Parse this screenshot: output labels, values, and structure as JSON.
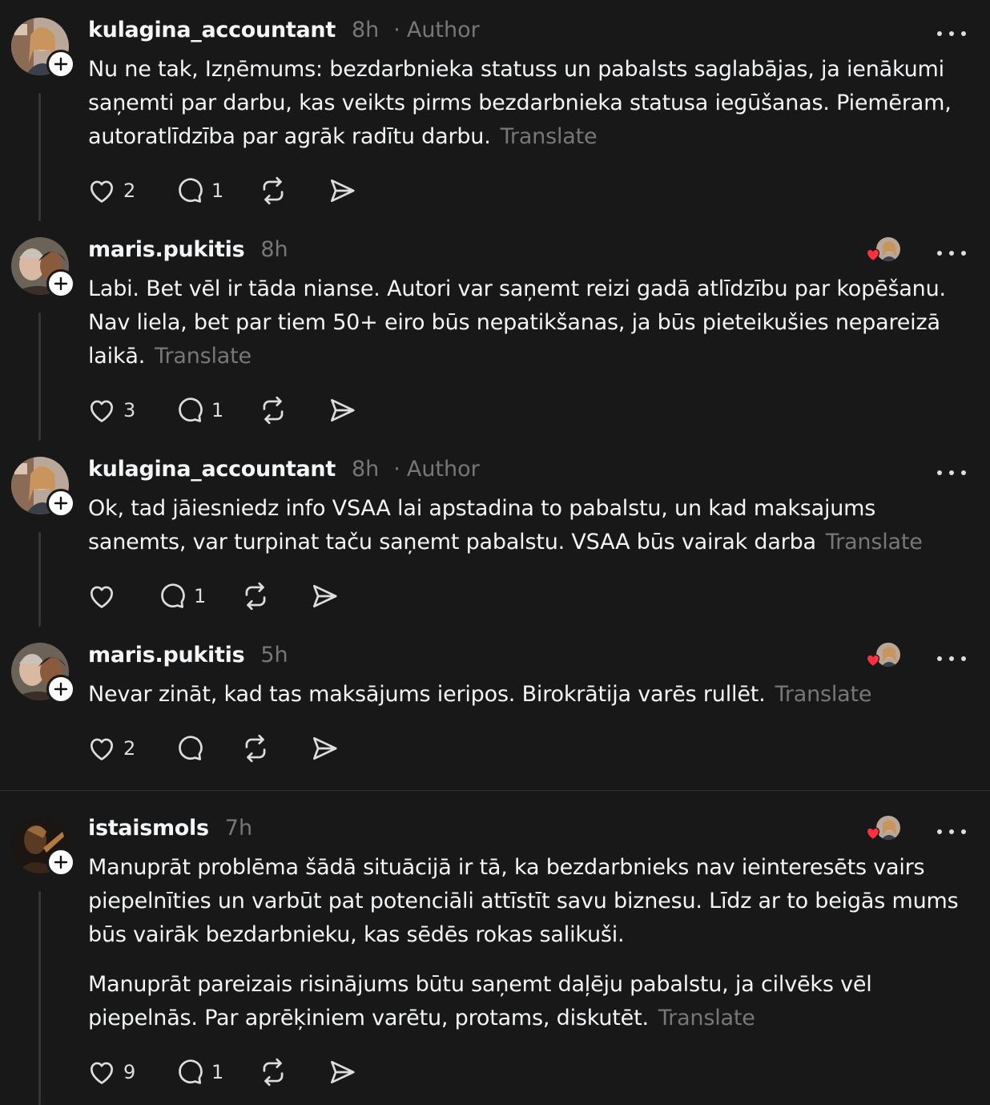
{
  "posts": [
    {
      "username": "kulagina_accountant",
      "time": "8h",
      "author_badge": "Author",
      "paragraphs": [
        "Nu ne tak, Izņēmums: bezdarbnieka statuss un pabalsts saglabājas, ja ienākumi saņemti par darbu, kas veikts pirms bezdarbnieka statusa iegūšanas. Piemēram, autoratlīdzība par agrāk radītu darbu."
      ],
      "translate": "Translate",
      "likes": "2",
      "replies": "1",
      "avatar_icon": "profile-photo-woman"
    },
    {
      "username": "maris.pukitis",
      "time": "8h",
      "paragraphs": [
        "Labi. Bet vēl ir tāda nianse. Autori var saņemt reizi gadā atlīdzību par kopēšanu. Nav liela, bet par tiem 50+ eiro būs nepatikšanas, ja būs pieteikušies nepareizā laikā."
      ],
      "translate": "Translate",
      "likes": "3",
      "replies": "1",
      "avatar_icon": "profile-photo-couple"
    },
    {
      "username": "kulagina_accountant",
      "time": "8h",
      "author_badge": "Author",
      "paragraphs": [
        "Ok, tad jāiesniedz info VSAA lai apstadina to pabalstu, un kad maksajums sanemts, var turpinat taču saņemt pabalstu. VSAA būs vairak darba"
      ],
      "translate": "Translate",
      "likes": "",
      "replies": "1",
      "avatar_icon": "profile-photo-woman"
    },
    {
      "username": "maris.pukitis",
      "time": "5h",
      "paragraphs": [
        "Nevar zināt, kad tas maksājums ieripos. Birokrātija varēs rullēt."
      ],
      "translate": "Translate",
      "likes": "2",
      "replies": "",
      "avatar_icon": "profile-photo-couple"
    },
    {
      "username": "istaismols",
      "time": "7h",
      "paragraphs": [
        "Manuprāt problēma šādā situācijā ir tā, ka bezdarbnieks nav ieinteresēts vairs piepelnīties un varbūt pat potenciāli attīstīt savu biznesu. Līdz ar to beigās mums būs vairāk bezdarbnieku, kas sēdēs rokas salikuši.",
        "Manuprāt pareizais risinājums būtu saņemt daļēju pabalstu, ja cilvēks vēl piepelnās. Par aprēķiniem varētu, protams, diskutēt."
      ],
      "translate": "Translate",
      "likes": "9",
      "replies": "1",
      "avatar_icon": "profile-photo-dark"
    }
  ],
  "colors": {
    "background": "#181818",
    "text": "#f3f5f7",
    "muted": "#777777",
    "heart": "#ff3040"
  }
}
